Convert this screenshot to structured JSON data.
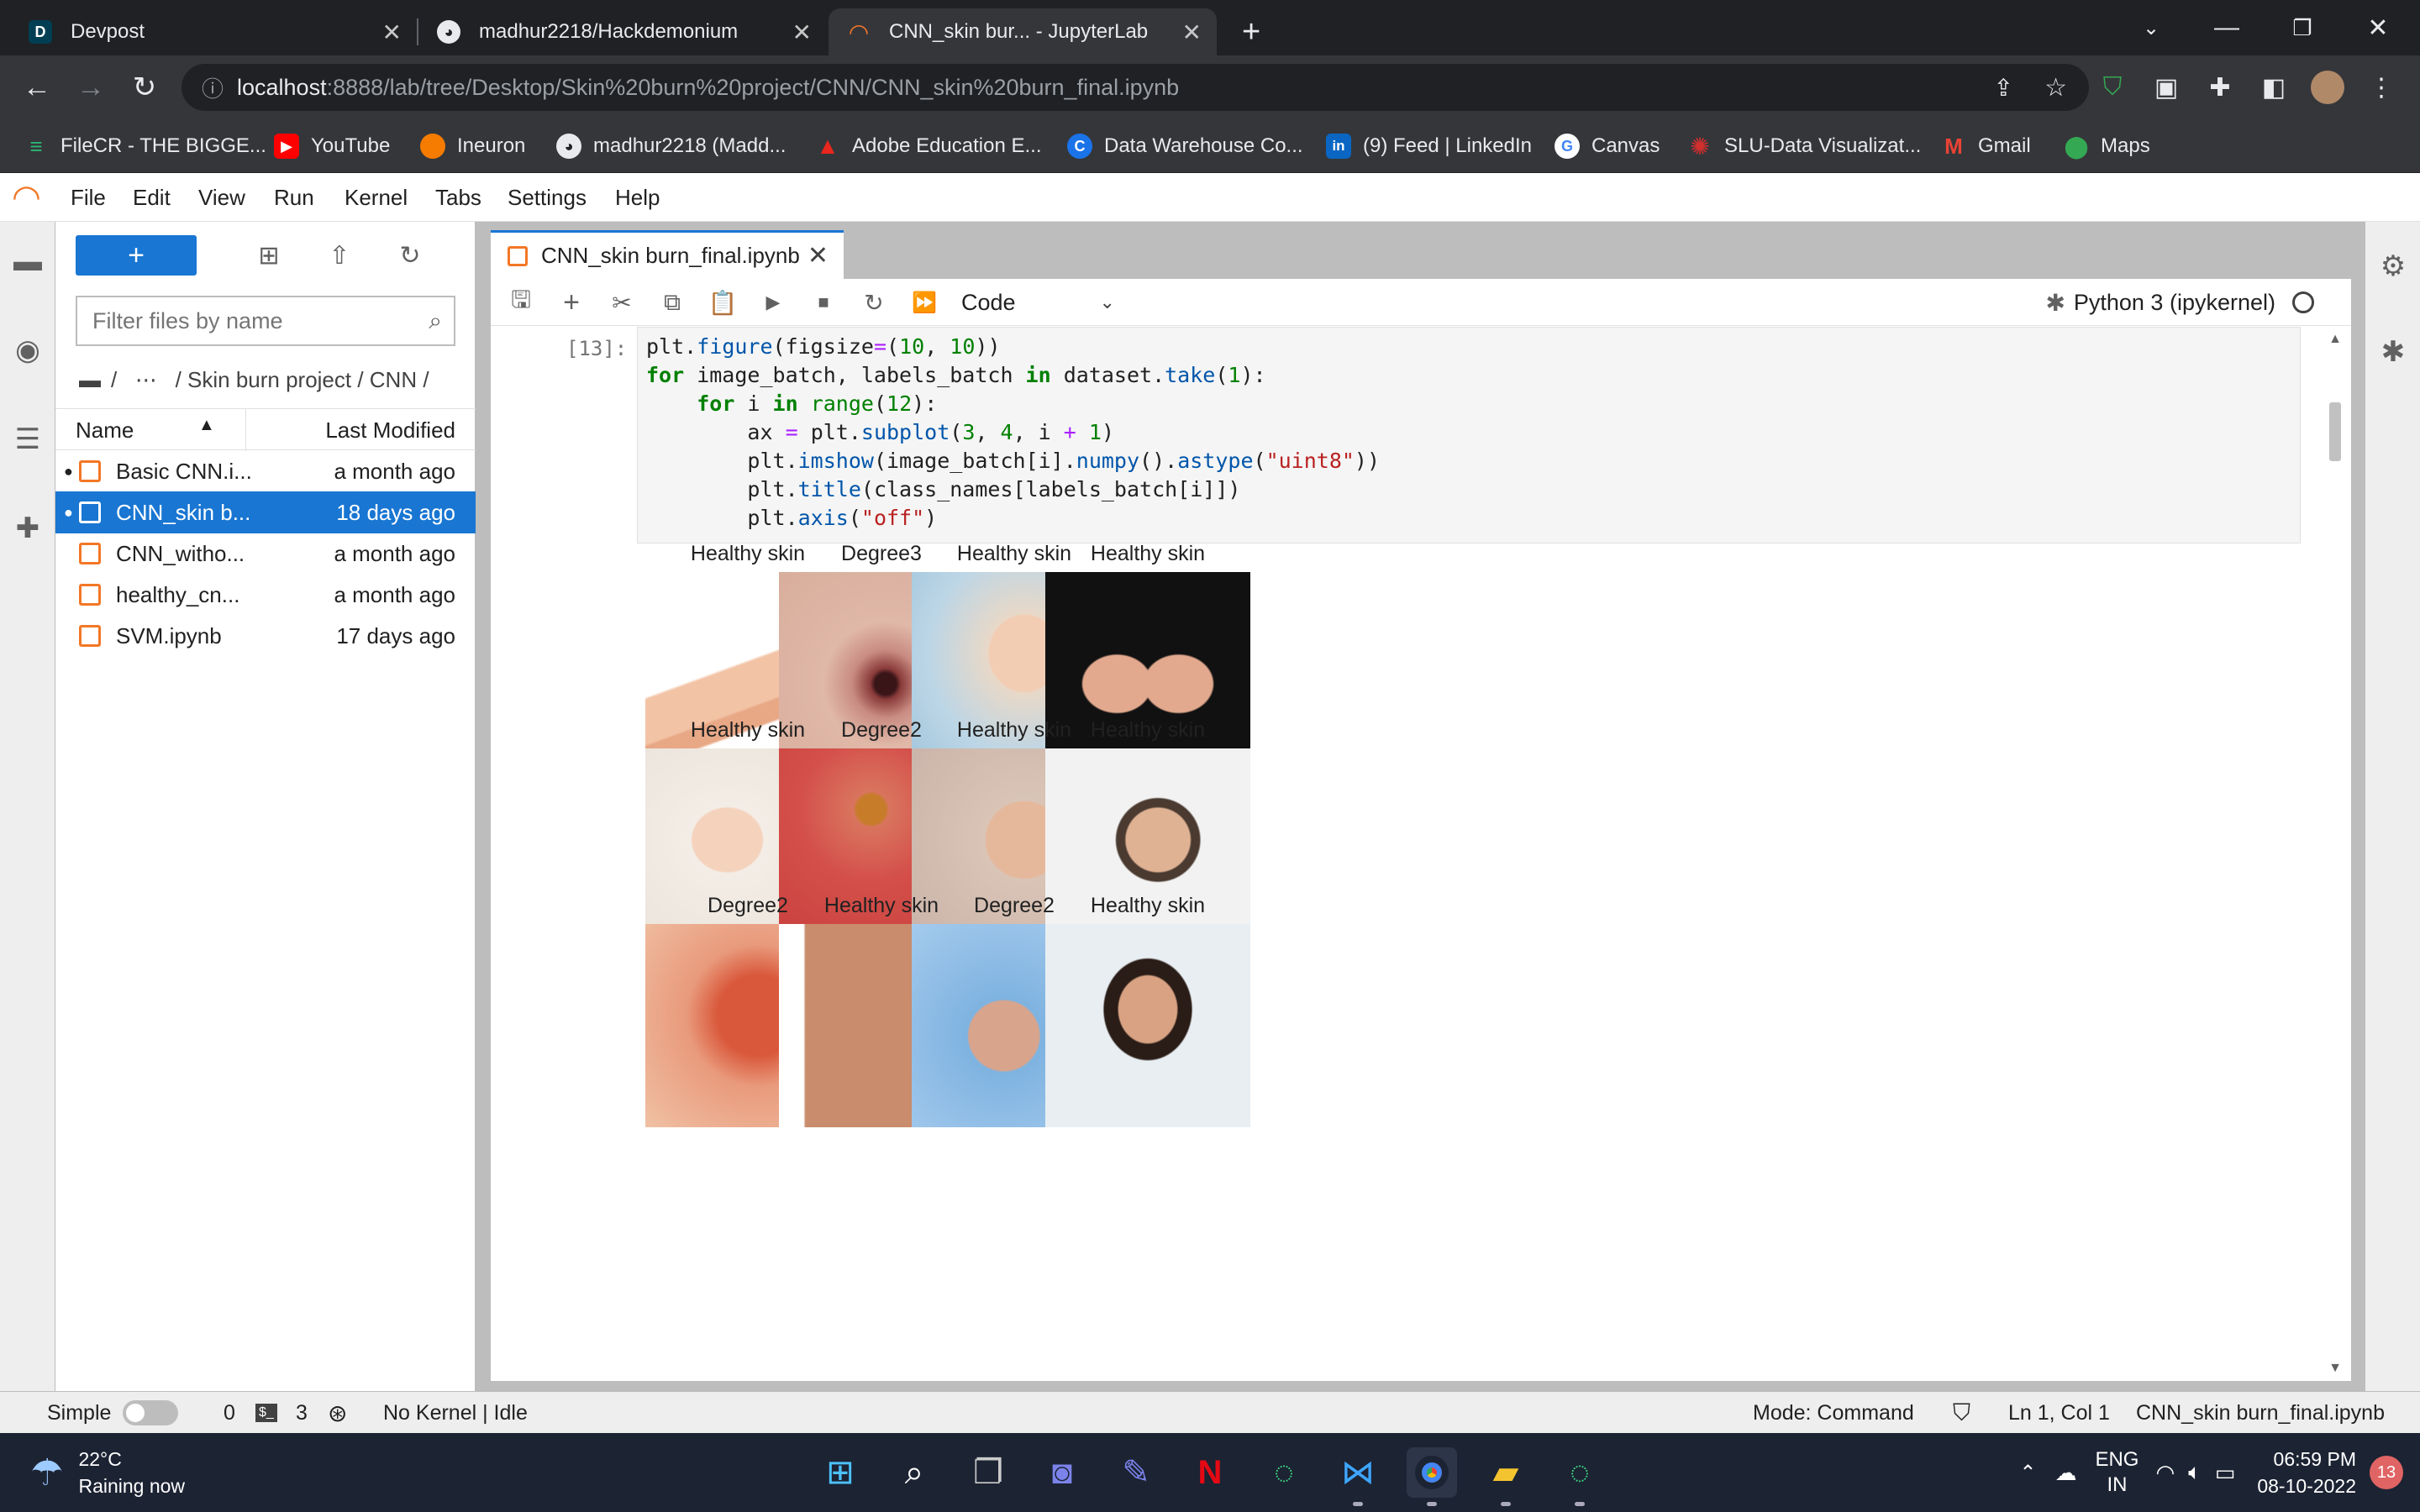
{
  "browser": {
    "tabs": [
      {
        "title": "Devpost",
        "favicon": "D"
      },
      {
        "title": "madhur2218/Hackdemonium",
        "favicon": "github-icon"
      },
      {
        "title": "CNN_skin bur... - JupyterLab",
        "favicon": "jupyter-icon"
      }
    ],
    "new_tab_label": "+",
    "url_host": "localhost",
    "url_path": ":8888/lab/tree/Desktop/Skin%20burn%20project/CNN/CNN_skin%20burn_final.ipynb",
    "bookmarks": [
      {
        "label": "FileCR - THE BIGGE...",
        "color": "#2bb673"
      },
      {
        "label": "YouTube",
        "color": "#ff0000"
      },
      {
        "label": "Ineuron",
        "color": "#f57c00"
      },
      {
        "label": "madhur2218 (Madd...",
        "color": "#333333"
      },
      {
        "label": "Adobe Education E...",
        "color": "#e8271f"
      },
      {
        "label": "Data Warehouse Co...",
        "color": "#1a73e8"
      },
      {
        "label": "(9) Feed | LinkedIn",
        "color": "#0a66c2"
      },
      {
        "label": "Canvas",
        "color": "#ffffff"
      },
      {
        "label": "SLU-Data Visualizat...",
        "color": "#d32f2f"
      },
      {
        "label": "Gmail",
        "color": "#ea4335"
      },
      {
        "label": "Maps",
        "color": "#34a853"
      }
    ]
  },
  "menu": [
    "File",
    "Edit",
    "View",
    "Run",
    "Kernel",
    "Tabs",
    "Settings",
    "Help"
  ],
  "filebrowser": {
    "new_label": "+",
    "filter_placeholder": "Filter files by name",
    "breadcrumb": "/   ⋯   / Skin burn project / CNN /",
    "col_name": "Name",
    "col_modified": "Last Modified",
    "files": [
      {
        "name": "Basic CNN.i...",
        "modified": "a month ago",
        "running": true,
        "selected": false
      },
      {
        "name": "CNN_skin b...",
        "modified": "18 days ago",
        "running": true,
        "selected": true
      },
      {
        "name": "CNN_witho...",
        "modified": "a month ago",
        "running": false,
        "selected": false
      },
      {
        "name": "healthy_cn...",
        "modified": "a month ago",
        "running": false,
        "selected": false
      },
      {
        "name": "SVM.ipynb",
        "modified": "17 days ago",
        "running": false,
        "selected": false
      }
    ]
  },
  "notebook": {
    "tab_title": "CNN_skin burn_final.ipynb",
    "cell_type": "Code",
    "kernel": "Python 3 (ipykernel)",
    "prompt": "[13]:",
    "code_lines": [
      "plt.figure(figsize=(10, 10))",
      "for image_batch, labels_batch in dataset.take(1):",
      "    for i in range(12):",
      "        ax = plt.subplot(3, 4, i + 1)",
      "        plt.imshow(image_batch[i].numpy().astype(\"uint8\"))",
      "        plt.title(class_names[labels_batch[i]])",
      "        plt.axis(\"off\")"
    ],
    "images": [
      {
        "title": "Healthy skin",
        "kind": "arm"
      },
      {
        "title": "Degree3",
        "kind": "burn3"
      },
      {
        "title": "Healthy skin",
        "kind": "face-spa"
      },
      {
        "title": "Healthy skin",
        "kind": "hands"
      },
      {
        "title": "Healthy skin",
        "kind": "baby"
      },
      {
        "title": "Degree2",
        "kind": "blister"
      },
      {
        "title": "Healthy skin",
        "kind": "face-woman"
      },
      {
        "title": "Healthy skin",
        "kind": "man"
      },
      {
        "title": "Degree2",
        "kind": "rash"
      },
      {
        "title": "Healthy skin",
        "kind": "torso"
      },
      {
        "title": "Degree2",
        "kind": "hand-burn"
      },
      {
        "title": "Healthy skin",
        "kind": "woman-smile"
      }
    ]
  },
  "status": {
    "simple": "Simple",
    "terminals_count": "0",
    "kernels_count": "3",
    "kernel_state": "No Kernel | Idle",
    "mode": "Mode: Command",
    "position": "Ln 1, Col 1",
    "file": "CNN_skin burn_final.ipynb"
  },
  "taskbar": {
    "temperature": "22°C",
    "weather": "Raining now",
    "lang_top": "ENG",
    "lang_bottom": "IN",
    "time": "06:59 PM",
    "date": "08-10-2022",
    "notifications": "13"
  }
}
